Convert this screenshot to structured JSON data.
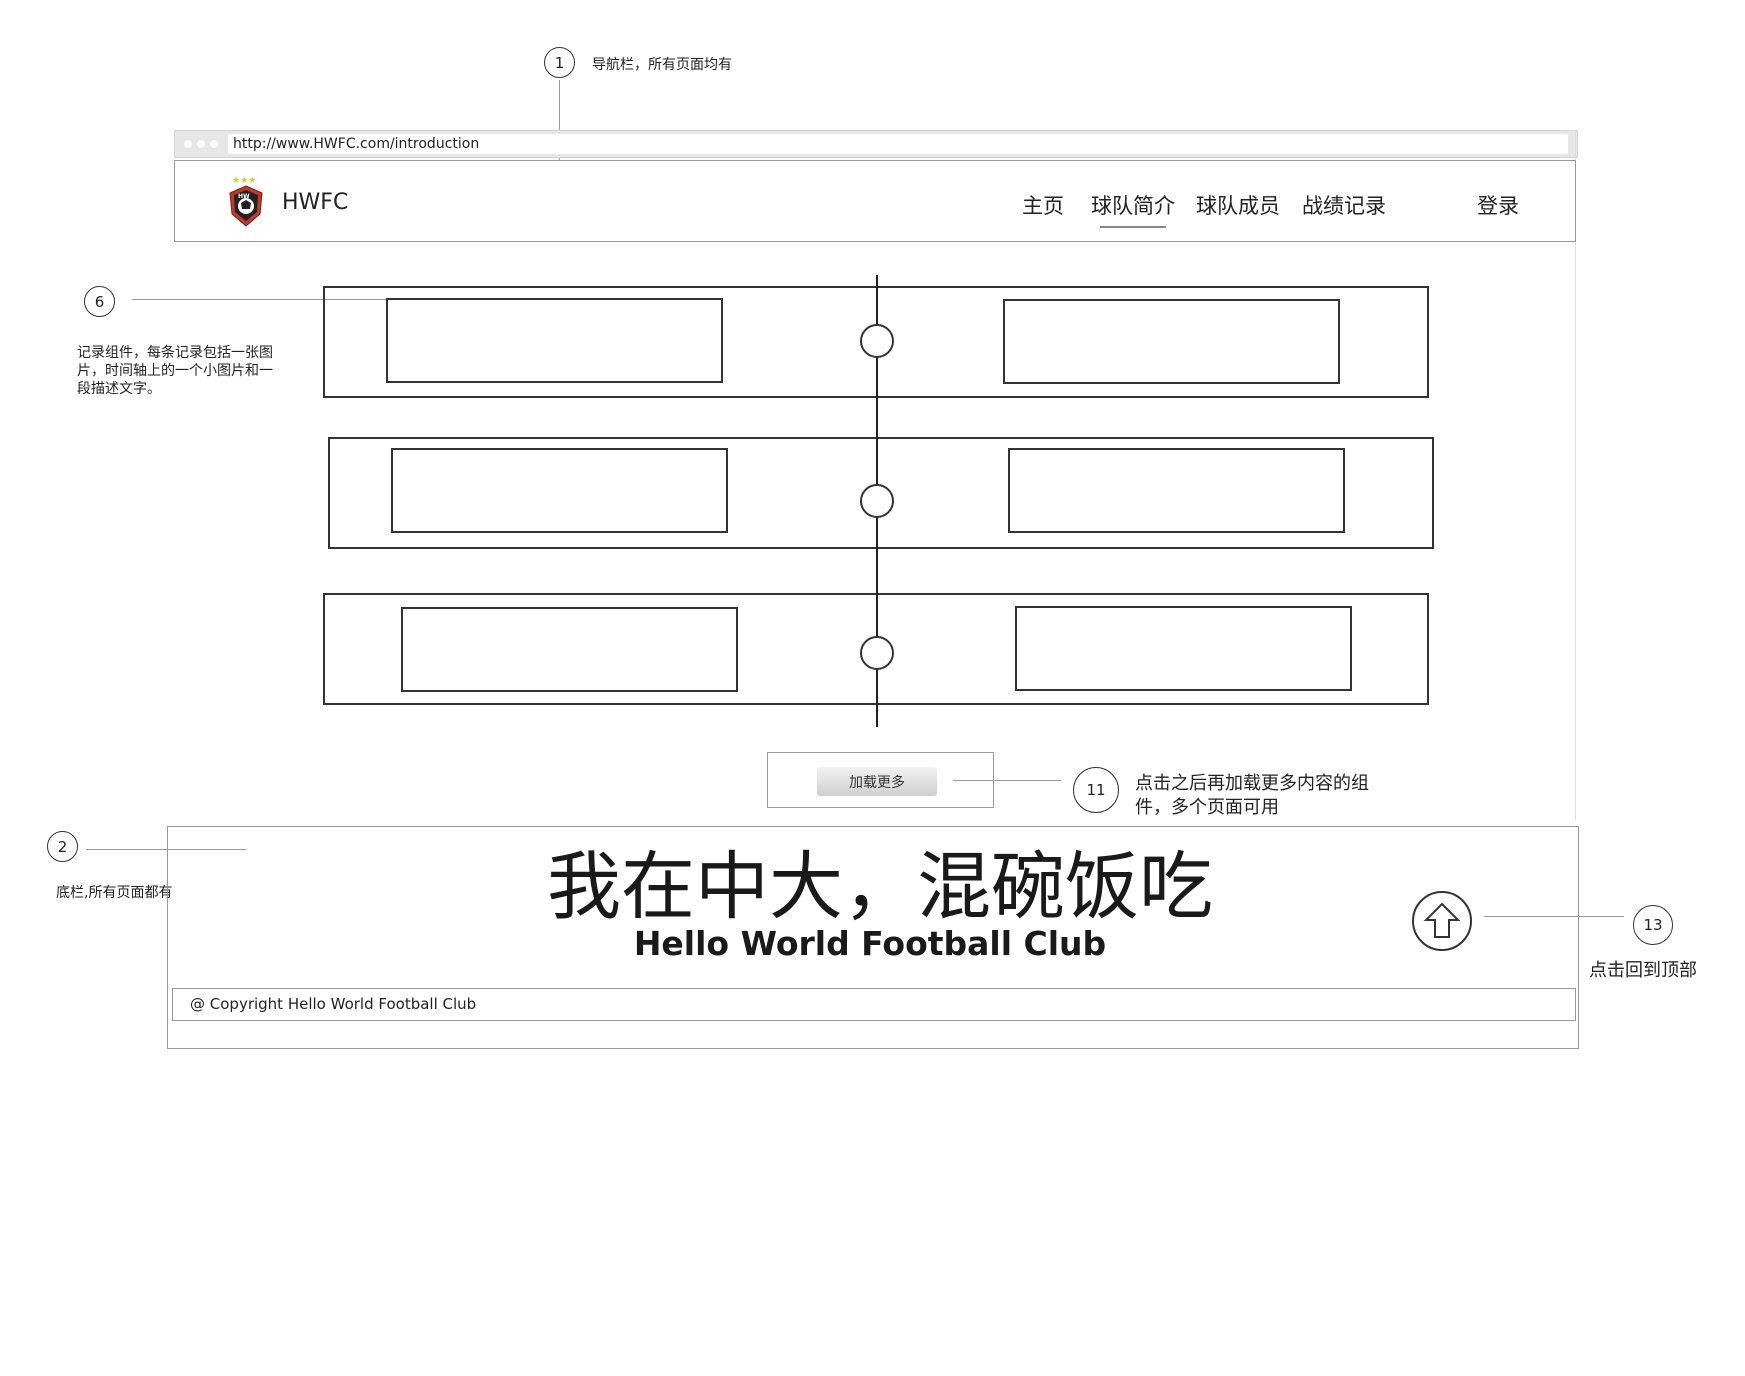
{
  "browser": {
    "url": "http://www.HWFC.com/introduction"
  },
  "navbar": {
    "brand": "HWFC",
    "items": [
      {
        "label": "主页"
      },
      {
        "label": "球队简介",
        "active": true
      },
      {
        "label": "球队成员"
      },
      {
        "label": "战绩记录"
      }
    ],
    "login_label": "登录"
  },
  "records": {
    "count": 3
  },
  "load_more": {
    "label": "加载更多"
  },
  "footer": {
    "slogan": "我在中大，混碗饭吃",
    "club_name": "Hello World Football Club",
    "copyright": "@ Copyright Hello World Football Club"
  },
  "annotations": {
    "a1": {
      "number": "1",
      "text": "导航栏，所有页面均有"
    },
    "a6": {
      "number": "6",
      "text": "记录组件，每条记录包括一张图片，时间轴上的一个小图片和一段描述文字。"
    },
    "a11": {
      "number": "11",
      "text": "点击之后再加载更多内容的组件，多个页面可用"
    },
    "a2": {
      "number": "2",
      "text": "底栏,所有页面都有"
    },
    "a13": {
      "number": "13",
      "text": "点击回到顶部"
    }
  },
  "colors": {
    "logo_red": "#c0392b",
    "logo_star": "#f1c40f",
    "line": "#333333"
  }
}
